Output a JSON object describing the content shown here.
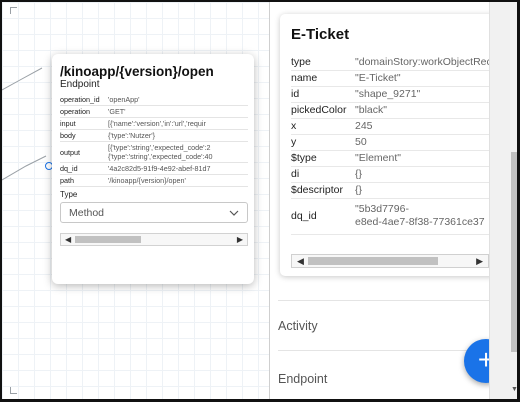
{
  "node": {
    "title": "/kinoapp/{version}/open",
    "subtitle": "Endpoint",
    "rows": [
      {
        "key": "operation_id",
        "value": "'openApp'"
      },
      {
        "key": "operation",
        "value": "'GET'"
      },
      {
        "key": "input",
        "value": "[{'name':'version','in':'url','requir"
      },
      {
        "key": "body",
        "value": "{'type':'Nutzer'}"
      },
      {
        "key": "output",
        "value": "[{'type':'string','expected_code':2\n{'type':'string','expected_code':40"
      },
      {
        "key": "dq_id",
        "value": "'4a2c82d5-91f9-4e92-abef-81d7"
      },
      {
        "key": "path",
        "value": "'/kinoapp/{version}/open'"
      }
    ],
    "type_label": "Type",
    "select_value": "Method"
  },
  "details": {
    "title": "E-Ticket",
    "rows": [
      {
        "key": "type",
        "value": "\"domainStory:workObjectRec"
      },
      {
        "key": "name",
        "value": "\"E-Ticket\""
      },
      {
        "key": "id",
        "value": "\"shape_9271\""
      },
      {
        "key": "pickedColor",
        "value": "\"black\""
      },
      {
        "key": "x",
        "value": "245"
      },
      {
        "key": "y",
        "value": "50"
      },
      {
        "key": "$type",
        "value": "\"Element\""
      },
      {
        "key": "di",
        "value": "{}"
      },
      {
        "key": "$descriptor",
        "value": "{}"
      },
      {
        "key": "dq_id",
        "value": "\"5b3d7796-\ne8ed-4ae7-8f38-77361ce37"
      }
    ]
  },
  "sections": {
    "activity": "Activity",
    "endpoint": "Endpoint"
  },
  "fab_label": "+",
  "colors": {
    "accent": "#1a73e8"
  }
}
